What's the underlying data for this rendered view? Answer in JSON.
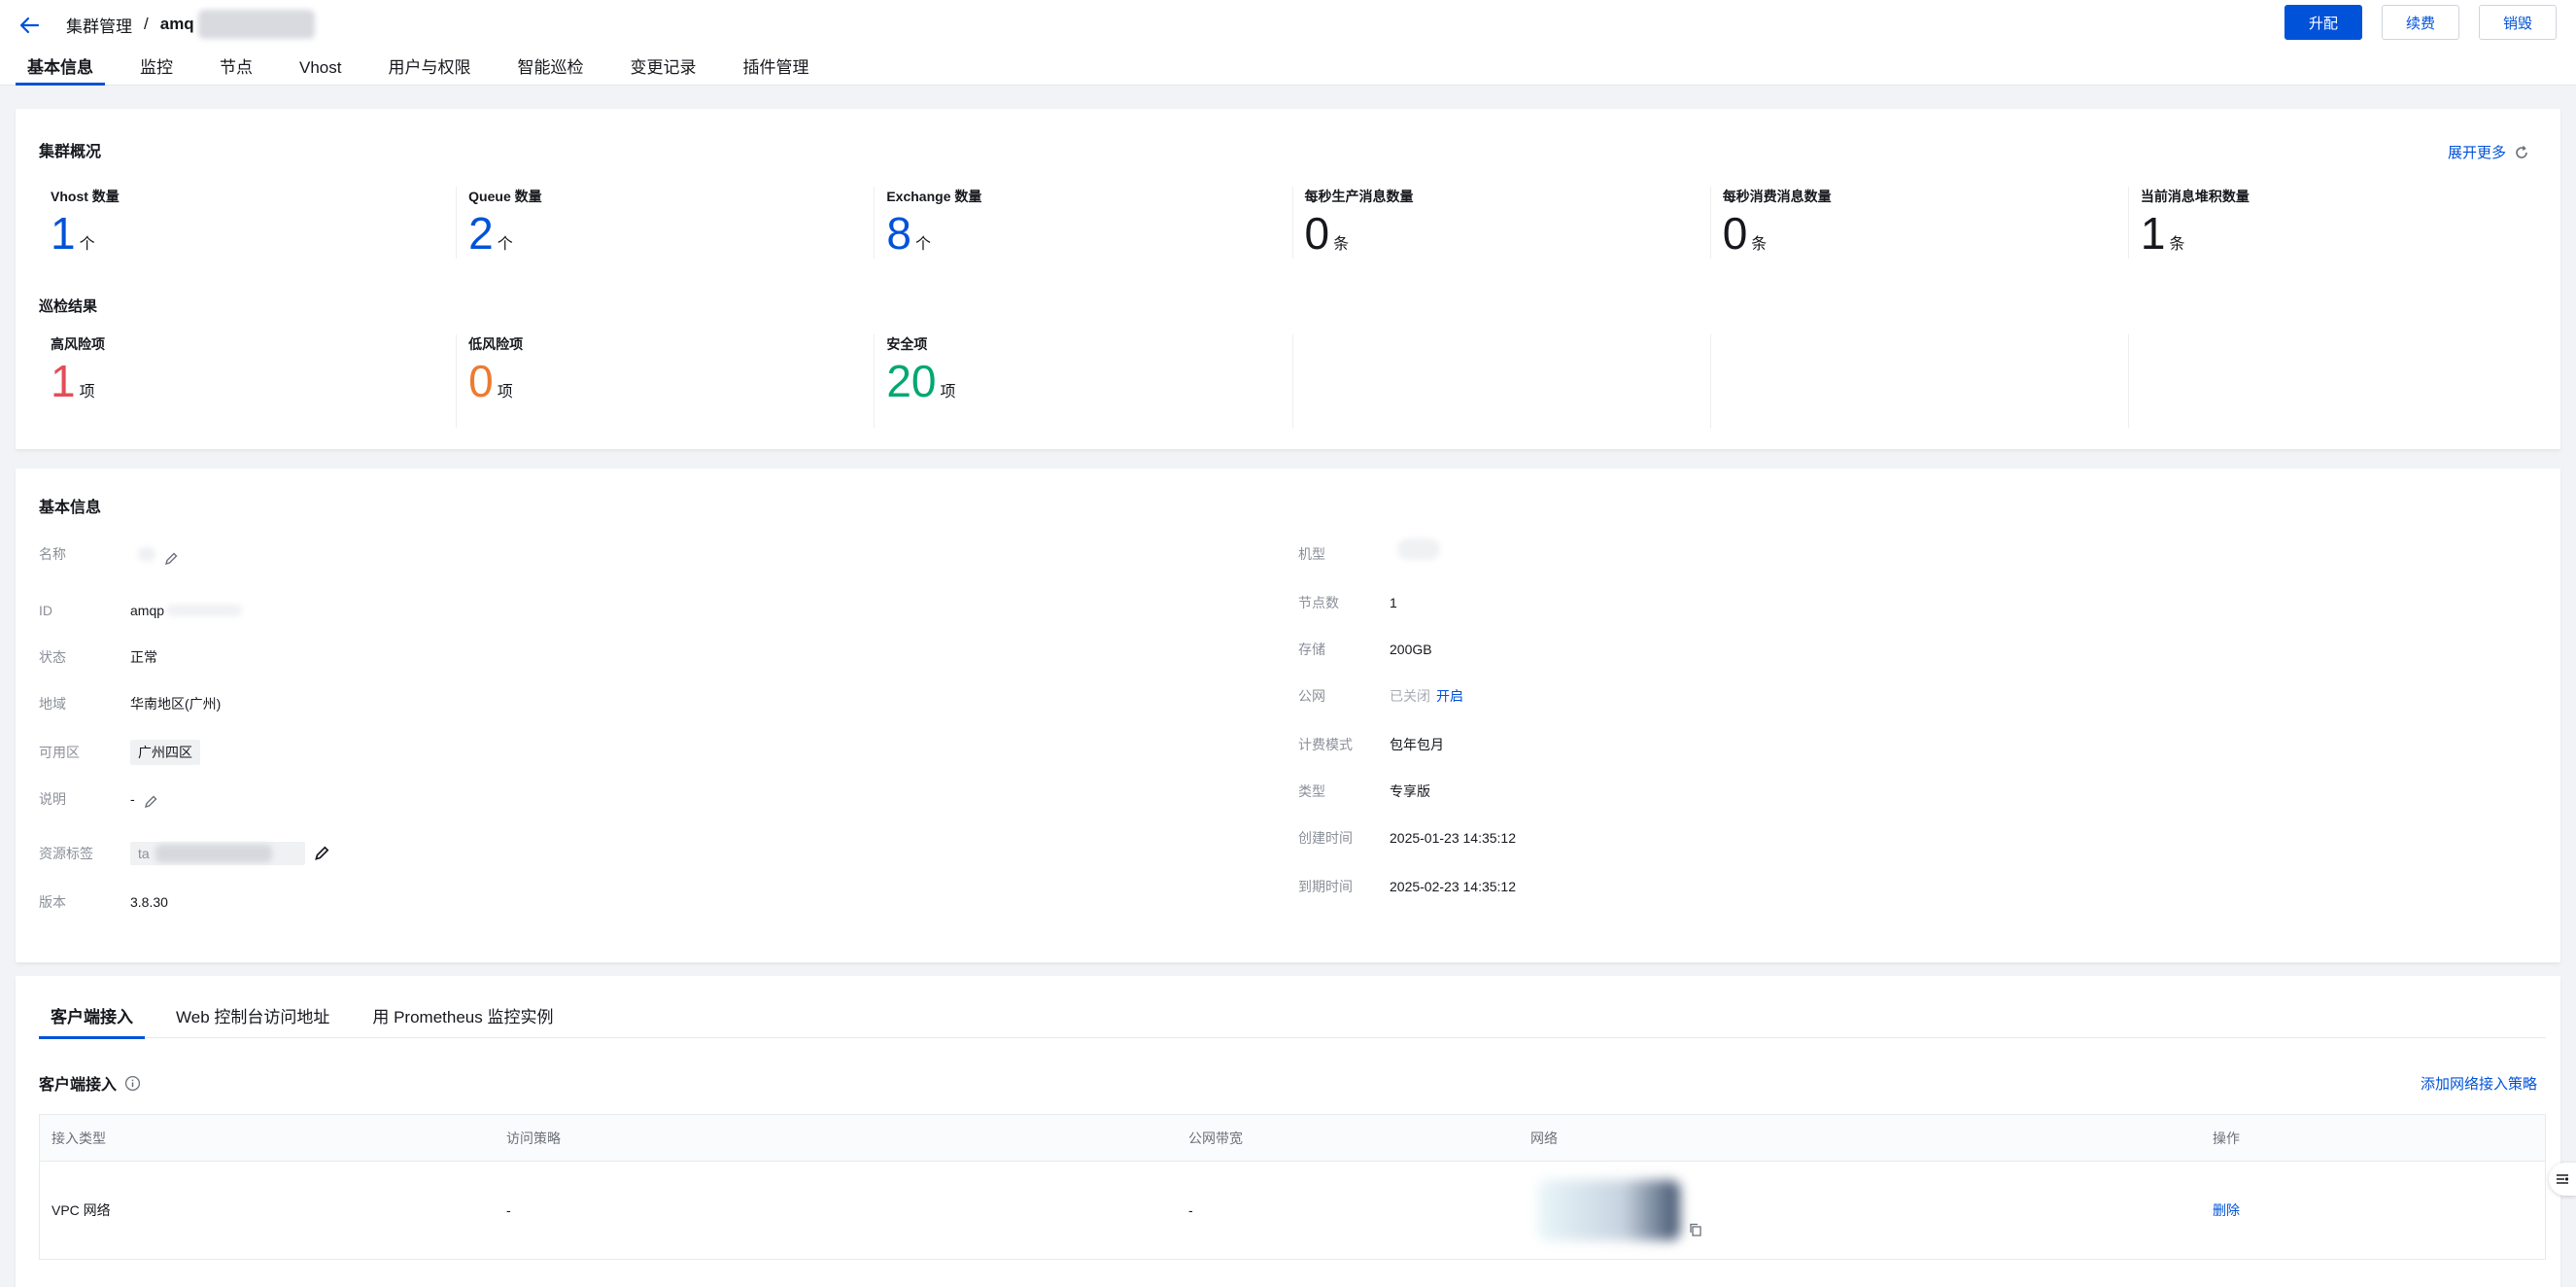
{
  "header": {
    "breadcrumb_parent": "集群管理",
    "breadcrumb_separator": "/",
    "breadcrumb_current": "amq",
    "actions": {
      "upgrade": "升配",
      "renew": "续费",
      "destroy": "销毁"
    }
  },
  "main_tabs": [
    "基本信息",
    "监控",
    "节点",
    "Vhost",
    "用户与权限",
    "智能巡检",
    "变更记录",
    "插件管理"
  ],
  "overview": {
    "title": "集群概况",
    "expand_more": "展开更多",
    "stats": [
      {
        "label": "Vhost 数量",
        "value": "1",
        "unit": "个"
      },
      {
        "label": "Queue 数量",
        "value": "2",
        "unit": "个"
      },
      {
        "label": "Exchange 数量",
        "value": "8",
        "unit": "个"
      },
      {
        "label": "每秒生产消息数量",
        "value": "0",
        "unit": "条"
      },
      {
        "label": "每秒消费消息数量",
        "value": "0",
        "unit": "条"
      },
      {
        "label": "当前消息堆积数量",
        "value": "1",
        "unit": "条"
      }
    ],
    "inspection_title": "巡检结果",
    "inspection": [
      {
        "label": "高风险项",
        "value": "1",
        "unit": "项"
      },
      {
        "label": "低风险项",
        "value": "0",
        "unit": "项"
      },
      {
        "label": "安全项",
        "value": "20",
        "unit": "项"
      }
    ]
  },
  "basic_info": {
    "title": "基本信息",
    "left": {
      "name_label": "名称",
      "name_value": "",
      "id_label": "ID",
      "id_value": "amqp",
      "status_label": "状态",
      "status_value": "正常",
      "region_label": "地域",
      "region_value": "华南地区(广州)",
      "zone_label": "可用区",
      "zone_value": "广州四区",
      "desc_label": "说明",
      "desc_value": "-",
      "tags_label": "资源标签",
      "tags_value": "ta",
      "version_label": "版本",
      "version_value": "3.8.30"
    },
    "right": {
      "spec_label": "机型",
      "spec_value": "",
      "nodes_label": "节点数",
      "nodes_value": "1",
      "storage_label": "存储",
      "storage_value": "200GB",
      "public_label": "公网",
      "public_status": "已关闭",
      "public_action": "开启",
      "billing_label": "计费模式",
      "billing_value": "包年包月",
      "type_label": "类型",
      "type_value": "专享版",
      "created_label": "创建时间",
      "created_value": "2025-01-23 14:35:12",
      "expire_label": "到期时间",
      "expire_value": "2025-02-23 14:35:12"
    }
  },
  "client_access": {
    "tabs": [
      "客户端接入",
      "Web 控制台访问地址",
      "用 Prometheus 监控实例"
    ],
    "section_title": "客户端接入",
    "add_policy": "添加网络接入策略",
    "columns": [
      "接入类型",
      "访问策略",
      "公网带宽",
      "网络",
      "操作"
    ],
    "rows": [
      {
        "type": "VPC 网络",
        "policy": "-",
        "bandwidth": "-",
        "network": "",
        "action": "删除"
      }
    ]
  },
  "colors": {
    "primary": "#0052d9",
    "success": "#00a870",
    "danger": "#e34d59",
    "warning": "#ed7b2f"
  }
}
